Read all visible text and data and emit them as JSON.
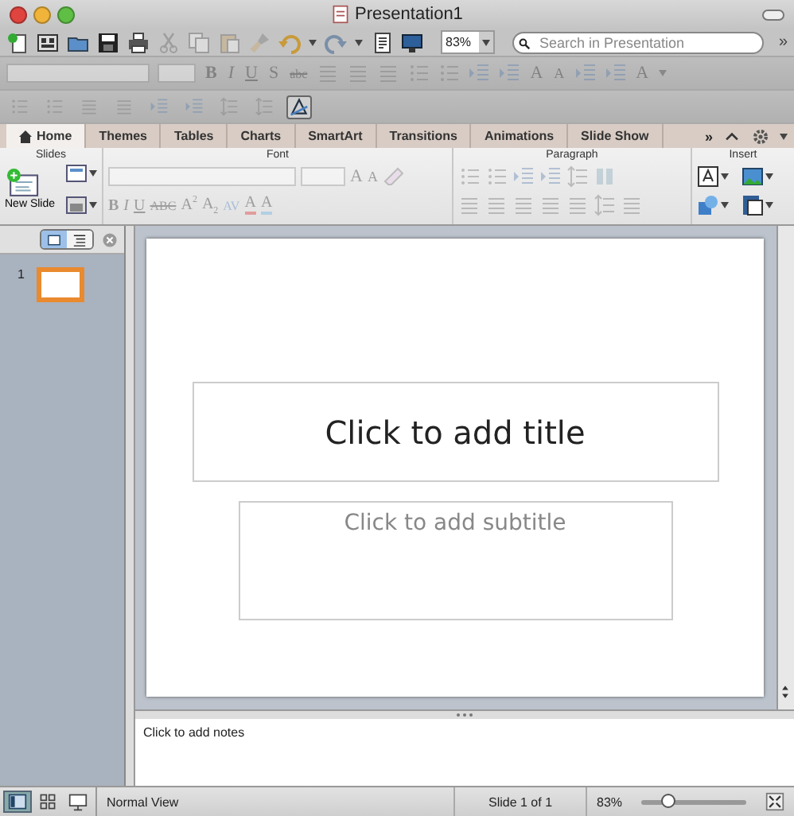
{
  "window": {
    "title": "Presentation1"
  },
  "toolbar": {
    "zoom": "83%",
    "search": {
      "placeholder": "Search in Presentation"
    },
    "overflow": "»"
  },
  "format_bar": {
    "disabled": true,
    "styles": [
      "B",
      "I",
      "U",
      "S",
      "abc"
    ],
    "size_buttons": [
      "A",
      "A"
    ],
    "color_button": "A"
  },
  "text_tools": [
    {
      "selected": false
    },
    {
      "selected": false
    },
    {
      "selected": false
    },
    {
      "selected": false
    },
    {
      "selected": false
    },
    {
      "selected": false
    },
    {
      "selected": false
    },
    {
      "selected": false
    },
    {
      "selected": true
    }
  ],
  "ribbon": {
    "tabs": [
      {
        "label": "Home",
        "selected": true
      },
      {
        "label": "Themes",
        "selected": false
      },
      {
        "label": "Tables",
        "selected": false
      },
      {
        "label": "Charts",
        "selected": false
      },
      {
        "label": "SmartArt",
        "selected": false
      },
      {
        "label": "Transitions",
        "selected": false
      },
      {
        "label": "Animations",
        "selected": false
      },
      {
        "label": "Slide Show",
        "selected": false
      }
    ],
    "overflow": "»",
    "slides_group": {
      "title": "Slides",
      "new_slide": "New Slide"
    },
    "font_group": {
      "title": "Font",
      "disabled": true,
      "size_buttons": [
        "A",
        "A"
      ],
      "styles": [
        "B",
        "I",
        "U",
        "ABC",
        "A$^{2}$",
        "A$_{2}$"
      ],
      "spacing": "AV",
      "color_letters": [
        "A",
        "A"
      ]
    },
    "paragraph_group": {
      "title": "Paragraph",
      "disabled": true
    },
    "insert_group": {
      "title": "Insert"
    }
  },
  "pane_views": [
    {
      "selected": true
    },
    {
      "selected": false
    }
  ],
  "thumbnails": [
    {
      "number": "1",
      "selected": true
    }
  ],
  "slide": {
    "title_placeholder": "Click to add title",
    "subtitle_placeholder": "Click to add subtitle"
  },
  "notes": {
    "placeholder": "Click to add notes"
  },
  "status_bar": {
    "views": [
      {
        "selected": true
      },
      {
        "selected": false
      },
      {
        "selected": false
      }
    ],
    "view_name": "Normal View",
    "slide_position": "Slide 1 of 1",
    "zoom": "83%",
    "zoom_slider": {
      "level": 0.25
    }
  }
}
